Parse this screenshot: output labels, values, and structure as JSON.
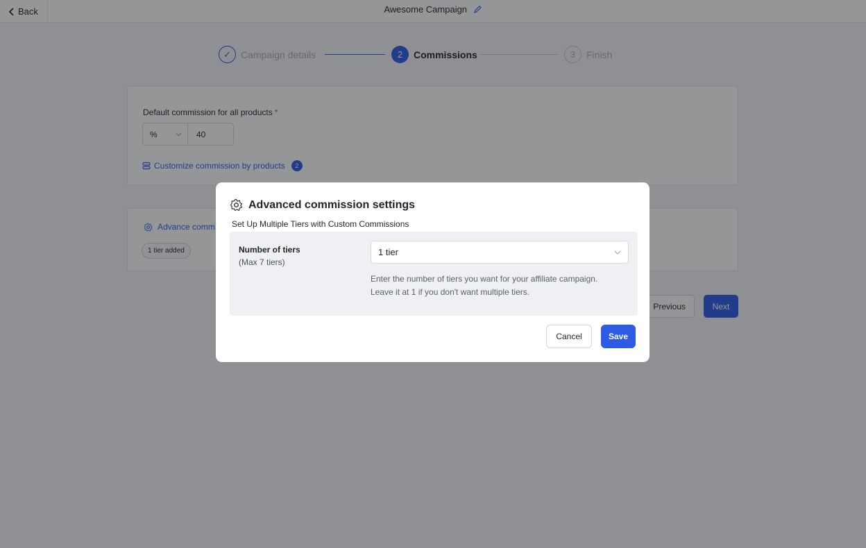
{
  "topbar": {
    "back_label": "Back",
    "campaign_title": "Awesome Campaign"
  },
  "stepper": {
    "steps": [
      {
        "number": "✓",
        "label": "Campaign details",
        "state": "done"
      },
      {
        "number": "2",
        "label": "Commissions",
        "state": "active"
      },
      {
        "number": "3",
        "label": "Finish",
        "state": "pending"
      }
    ]
  },
  "commission_card": {
    "label": "Default commission for all products",
    "required_mark": "*",
    "unit_value": "%",
    "amount_value": "40",
    "customize_label": "Customize commission by products",
    "customize_count": "2"
  },
  "advance_card": {
    "link_label": "Advance comm",
    "tier_chip": "1 tier added"
  },
  "footer": {
    "previous_label": "Previous",
    "next_label": "Next"
  },
  "modal": {
    "title": "Advanced commission settings",
    "subtitle": "Set Up Multiple Tiers with Custom Commissions",
    "tiers_label": "Number of tiers",
    "tiers_max": "(Max 7 tiers)",
    "tiers_selected": "1 tier",
    "help_line_1": "Enter the number of tiers you want for your affiliate campaign.",
    "help_line_2": "Leave it at 1 if you don't want multiple tiers.",
    "cancel_label": "Cancel",
    "save_label": "Save"
  },
  "colors": {
    "accent": "#2d5be3",
    "required": "#d93b3b"
  }
}
